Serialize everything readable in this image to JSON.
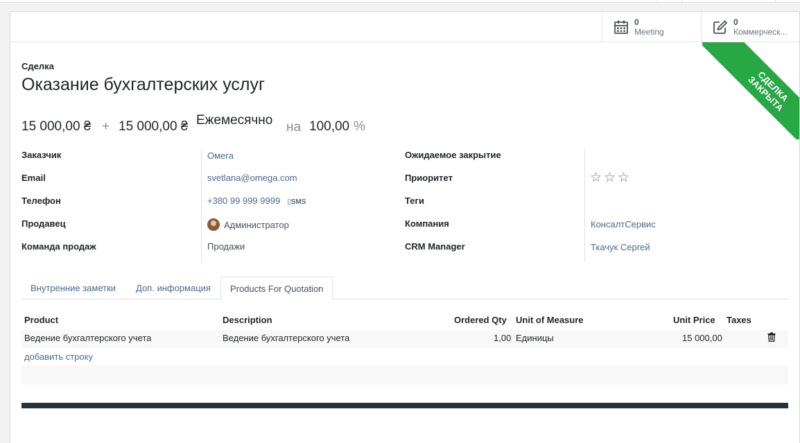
{
  "stat_buttons": {
    "meeting": {
      "value": "0",
      "label": "Meeting"
    },
    "commercial": {
      "value": "0",
      "label": "Коммерческ..."
    }
  },
  "ribbon": {
    "line1": "СДЕЛКА",
    "line2": "ЗАКРЫТА",
    "color": "#28a745"
  },
  "header": {
    "label": "Сделка",
    "title": "Оказание бухгалтерских услуг"
  },
  "amounts": {
    "expected": "15 000,00 ₴",
    "plus": "+",
    "recurring": "15 000,00 ₴",
    "period": "Ежемесячно",
    "on": "на",
    "probability": "100,00",
    "percent": "%"
  },
  "left_fields": [
    {
      "label": "Заказчик",
      "value": "Омега"
    },
    {
      "label": "Email",
      "value": "svetlana@omega.com"
    },
    {
      "label": "Телефон",
      "value": "+380 99 999 9999",
      "sms": "SMS"
    },
    {
      "label": "Продавец",
      "value": "Администратор"
    },
    {
      "label": "Команда продаж",
      "value": "Продажи"
    }
  ],
  "right_fields": [
    {
      "label": "Ожидаемое закрытие",
      "value": ""
    },
    {
      "label": "Приоритет",
      "stars": "☆☆☆"
    },
    {
      "label": "Теги",
      "value": ""
    },
    {
      "label": "Компания",
      "value": "КонсалтСервис"
    },
    {
      "label": "CRM Manager",
      "value": "Ткачук Сергей"
    }
  ],
  "tabs": [
    "Внутренние заметки",
    "Доп. информация",
    "Products For Quotation"
  ],
  "table": {
    "headers": [
      "Product",
      "Description",
      "Ordered Qty",
      "Unit of Measure",
      "Unit Price",
      "Taxes"
    ],
    "rows": [
      {
        "product": "Ведение бухгалтерского учета",
        "description": "Ведение бухгалтерского учета",
        "qty": "1,00",
        "uom": "Единицы",
        "price": "15 000,00",
        "taxes": ""
      }
    ],
    "add_line": "добавить строку"
  },
  "colors": {
    "link": "#4a6a88",
    "dark_bar": "#263238"
  }
}
